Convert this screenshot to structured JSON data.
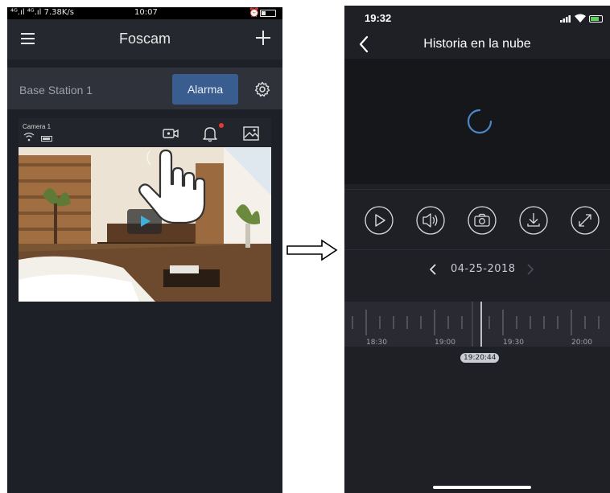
{
  "left_screen": {
    "status_bar": {
      "signal_text": "⁴ᴳ.ıl ⁴ᴳ.ıl 7.38K/s",
      "time": "10:07"
    },
    "nav": {
      "title": "Foscam",
      "menu_icon": "hamburger-icon",
      "add_icon": "plus-icon"
    },
    "station": {
      "name": "Base Station 1",
      "alarm_label": "Alarma",
      "settings_icon": "gear-icon"
    },
    "camera": {
      "name": "Camera 1",
      "icons": [
        "wifi-icon",
        "battery-icon",
        "video-icon",
        "bell-icon",
        "image-icon"
      ],
      "notification_color": "#e53935",
      "play_color": "#3fb0d9"
    }
  },
  "right_screen": {
    "status_bar": {
      "time": "19:32"
    },
    "nav": {
      "title": "Historia en la nube",
      "back_icon": "chevron-left-icon"
    },
    "controls": [
      "play-icon",
      "speaker-icon",
      "camera-icon",
      "download-icon",
      "fullscreen-icon"
    ],
    "date": {
      "value": "04-25-2018"
    },
    "timeline": {
      "labels": [
        "18:30",
        "19:00",
        "19:30",
        "20:00"
      ],
      "current_time": "19:20:44"
    }
  },
  "colors": {
    "accent_button": "#3a5d8f",
    "background_dark": "#1f2026"
  }
}
